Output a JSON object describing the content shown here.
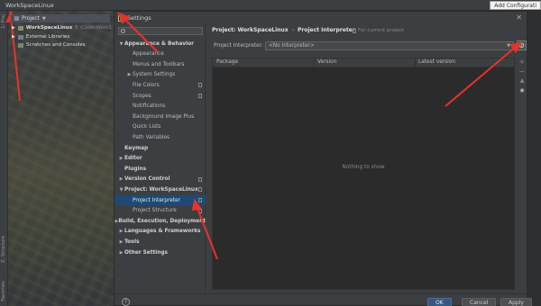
{
  "ide": {
    "window_title": "WorkSpaceLinux",
    "add_config": "Add Configurati",
    "left_strip_labels": [
      "1: Proj",
      "Z: Structure",
      "Favorites"
    ],
    "project_panel": {
      "header": "Project",
      "items": [
        {
          "label": "WorkSpaceLinux",
          "extra": "E:\\Code\\WorkS"
        },
        {
          "label": "External Libraries",
          "extra": ""
        },
        {
          "label": "Scratches and Consoles",
          "extra": ""
        }
      ]
    }
  },
  "dialog": {
    "title": "Settings",
    "search_placeholder": "",
    "tree": [
      {
        "label": "Appearance & Behavior",
        "bold": true,
        "arrow": "▼",
        "indent": 0
      },
      {
        "label": "Appearance",
        "bold": false,
        "arrow": "",
        "indent": 1
      },
      {
        "label": "Menus and Toolbars",
        "bold": false,
        "arrow": "",
        "indent": 1
      },
      {
        "label": "System Settings",
        "bold": false,
        "arrow": "▶",
        "indent": 1
      },
      {
        "label": "File Colors",
        "bold": false,
        "arrow": "",
        "indent": 1,
        "copy": true
      },
      {
        "label": "Scopes",
        "bold": false,
        "arrow": "",
        "indent": 1,
        "copy": true
      },
      {
        "label": "Notifications",
        "bold": false,
        "arrow": "",
        "indent": 1
      },
      {
        "label": "Background Image Plus",
        "bold": false,
        "arrow": "",
        "indent": 1
      },
      {
        "label": "Quick Lists",
        "bold": false,
        "arrow": "",
        "indent": 1
      },
      {
        "label": "Path Variables",
        "bold": false,
        "arrow": "",
        "indent": 1
      },
      {
        "label": "Keymap",
        "bold": true,
        "arrow": "",
        "indent": 0
      },
      {
        "label": "Editor",
        "bold": true,
        "arrow": "▶",
        "indent": 0
      },
      {
        "label": "Plugins",
        "bold": true,
        "arrow": "",
        "indent": 0
      },
      {
        "label": "Version Control",
        "bold": true,
        "arrow": "▶",
        "indent": 0,
        "copy": true
      },
      {
        "label": "Project: WorkSpaceLinux",
        "bold": true,
        "arrow": "▼",
        "indent": 0,
        "copy": true
      },
      {
        "label": "Project Interpreter",
        "bold": false,
        "arrow": "",
        "indent": 1,
        "copy": true,
        "selected": true
      },
      {
        "label": "Project Structure",
        "bold": false,
        "arrow": "",
        "indent": 1,
        "copy": true
      },
      {
        "label": "Build, Execution, Deployment",
        "bold": true,
        "arrow": "▶",
        "indent": 0
      },
      {
        "label": "Languages & Frameworks",
        "bold": true,
        "arrow": "▶",
        "indent": 0
      },
      {
        "label": "Tools",
        "bold": true,
        "arrow": "▶",
        "indent": 0
      },
      {
        "label": "Other Settings",
        "bold": true,
        "arrow": "▶",
        "indent": 0
      }
    ],
    "breadcrumb": {
      "parent": "Project: WorkSpaceLinux",
      "separator": "›",
      "current": "Project Interpreter",
      "scope_note": "For current project"
    },
    "interpreter": {
      "label": "Project Interpreter:",
      "value": "<No interpreter>"
    },
    "table": {
      "columns": [
        "Package",
        "Version",
        "Latest version"
      ],
      "empty_text": "Nothing to show"
    },
    "side_tools": [
      "+",
      "−",
      "▲",
      "◉"
    ],
    "footer": {
      "help": "?",
      "ok": "OK",
      "cancel": "Cancel",
      "apply": "Apply"
    }
  },
  "colors": {
    "annotation_red": "#e8322a",
    "selection_blue": "#1e4a74"
  }
}
